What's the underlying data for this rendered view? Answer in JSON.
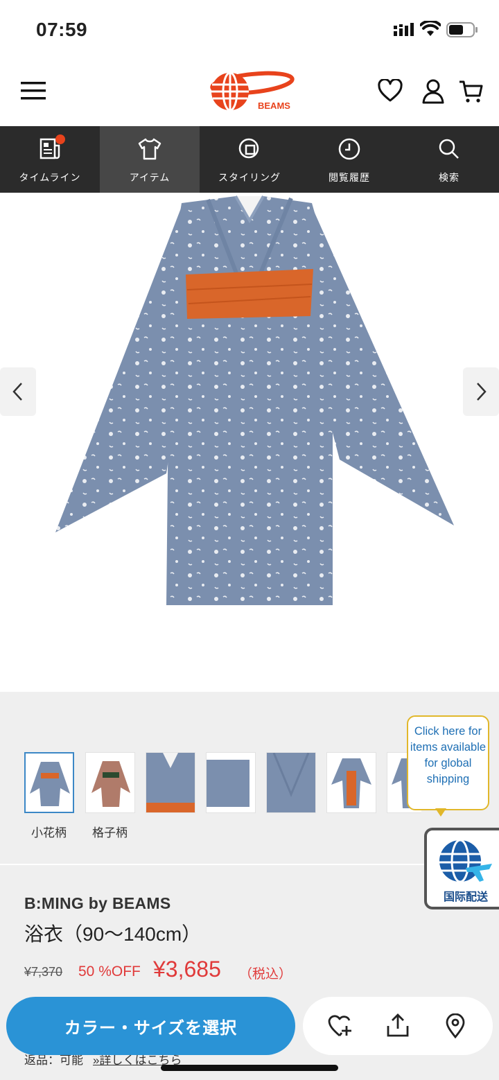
{
  "status_bar": {
    "time": "07:59"
  },
  "header": {
    "logo_text": "BEAMS"
  },
  "nav": {
    "tabs": [
      {
        "label": "タイムライン",
        "icon": "newspaper-icon",
        "badge": true
      },
      {
        "label": "アイテム",
        "icon": "tshirt-icon",
        "active": true
      },
      {
        "label": "スタイリング",
        "icon": "styling-icon"
      },
      {
        "label": "閲覧履歴",
        "icon": "clock-icon"
      },
      {
        "label": "検索",
        "icon": "search-icon"
      }
    ]
  },
  "thumbnails": {
    "labels": [
      "小花柄",
      "格子柄"
    ],
    "selected_index": 0
  },
  "global_shipping": {
    "bubble_text": "Click here for items available for global shipping",
    "label": "国际配送"
  },
  "product": {
    "brand": "B:MING by BEAMS",
    "name": "浴衣（90〜140cm）",
    "original_price": "¥7,370",
    "discount": "50 %OFF",
    "price": "¥3,685",
    "tax_note": "（税込）",
    "return_label": "返品：可能",
    "return_link": "»詳しくはこちら"
  },
  "actions": {
    "select_button": "カラー・サイズを選択"
  },
  "colors": {
    "accent": "#2a93d6",
    "sale": "#e03a3a",
    "nav_bg": "#2b2b2b",
    "logo": "#e8431c"
  }
}
